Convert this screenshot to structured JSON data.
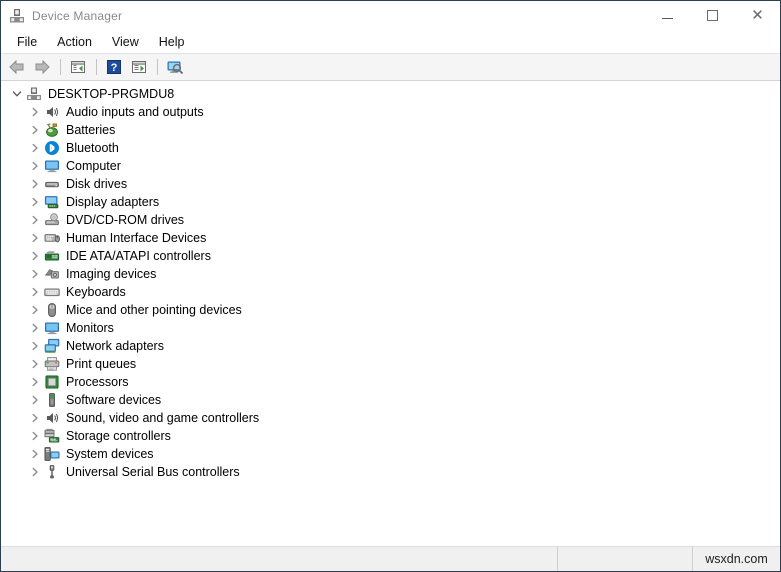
{
  "window": {
    "title": "Device Manager",
    "title_icon": "computer-icon",
    "controls": [
      {
        "name": "minimize-button",
        "label": "—"
      },
      {
        "name": "maximize-button",
        "label": "□"
      },
      {
        "name": "close-button",
        "label": "✕"
      }
    ]
  },
  "menubar": {
    "items": [
      {
        "label": "File"
      },
      {
        "label": "Action"
      },
      {
        "label": "View"
      },
      {
        "label": "Help"
      }
    ]
  },
  "toolbar": {
    "buttons": [
      {
        "name": "back-button",
        "icon": "arrow-left-icon"
      },
      {
        "name": "forward-button",
        "icon": "arrow-right-icon"
      },
      {
        "name": "show-hide-console-tree-button",
        "icon": "console-tree-icon"
      },
      {
        "name": "help-button",
        "icon": "question-mark-icon"
      },
      {
        "name": "properties-button",
        "icon": "properties-icon"
      },
      {
        "name": "scan-for-hardware-changes-button",
        "icon": "scan-hardware-icon"
      }
    ]
  },
  "tree": {
    "root": {
      "label": "DESKTOP-PRGMDU8",
      "icon": "computer-icon",
      "expanded": true,
      "chevron": "chevron-down-icon"
    },
    "items": [
      {
        "label": "Audio inputs and outputs",
        "icon": "speaker-icon",
        "chevron": "chevron-right-icon"
      },
      {
        "label": "Batteries",
        "icon": "battery-icon",
        "chevron": "chevron-right-icon"
      },
      {
        "label": "Bluetooth",
        "icon": "bluetooth-icon",
        "chevron": "chevron-right-icon"
      },
      {
        "label": "Computer",
        "icon": "monitor-icon",
        "chevron": "chevron-right-icon"
      },
      {
        "label": "Disk drives",
        "icon": "disk-drive-icon",
        "chevron": "chevron-right-icon"
      },
      {
        "label": "Display adapters",
        "icon": "display-adapter-icon",
        "chevron": "chevron-right-icon"
      },
      {
        "label": "DVD/CD-ROM drives",
        "icon": "dvd-drive-icon",
        "chevron": "chevron-right-icon"
      },
      {
        "label": "Human Interface Devices",
        "icon": "hid-icon",
        "chevron": "chevron-right-icon"
      },
      {
        "label": "IDE ATA/ATAPI controllers",
        "icon": "ide-controller-icon",
        "chevron": "chevron-right-icon"
      },
      {
        "label": "Imaging devices",
        "icon": "camera-icon",
        "chevron": "chevron-right-icon"
      },
      {
        "label": "Keyboards",
        "icon": "keyboard-icon",
        "chevron": "chevron-right-icon"
      },
      {
        "label": "Mice and other pointing devices",
        "icon": "mouse-icon",
        "chevron": "chevron-right-icon"
      },
      {
        "label": "Monitors",
        "icon": "monitor-icon",
        "chevron": "chevron-right-icon"
      },
      {
        "label": "Network adapters",
        "icon": "network-adapter-icon",
        "chevron": "chevron-right-icon"
      },
      {
        "label": "Print queues",
        "icon": "printer-icon",
        "chevron": "chevron-right-icon"
      },
      {
        "label": "Processors",
        "icon": "processor-icon",
        "chevron": "chevron-right-icon"
      },
      {
        "label": "Software devices",
        "icon": "software-device-icon",
        "chevron": "chevron-right-icon"
      },
      {
        "label": "Sound, video and game controllers",
        "icon": "speaker-icon",
        "chevron": "chevron-right-icon"
      },
      {
        "label": "Storage controllers",
        "icon": "storage-controller-icon",
        "chevron": "chevron-right-icon"
      },
      {
        "label": "System devices",
        "icon": "system-device-icon",
        "chevron": "chevron-right-icon"
      },
      {
        "label": "Universal Serial Bus controllers",
        "icon": "usb-icon",
        "chevron": "chevron-right-icon"
      }
    ]
  },
  "statusbar": {
    "pane1": "",
    "pane2": "",
    "watermark": "wsxdn.com"
  },
  "colors": {
    "bluetooth_blue": "#0a84d8",
    "monitor_blue": "#4fa8e8",
    "board_green": "#2e8b3d",
    "chevron_gray": "#7a7a7a",
    "title_gray": "#8a8a8a",
    "window_border": "#2c3e50",
    "toolbar_bg": "#f5f5f5",
    "statusbar_bg": "#f0f0f0"
  }
}
